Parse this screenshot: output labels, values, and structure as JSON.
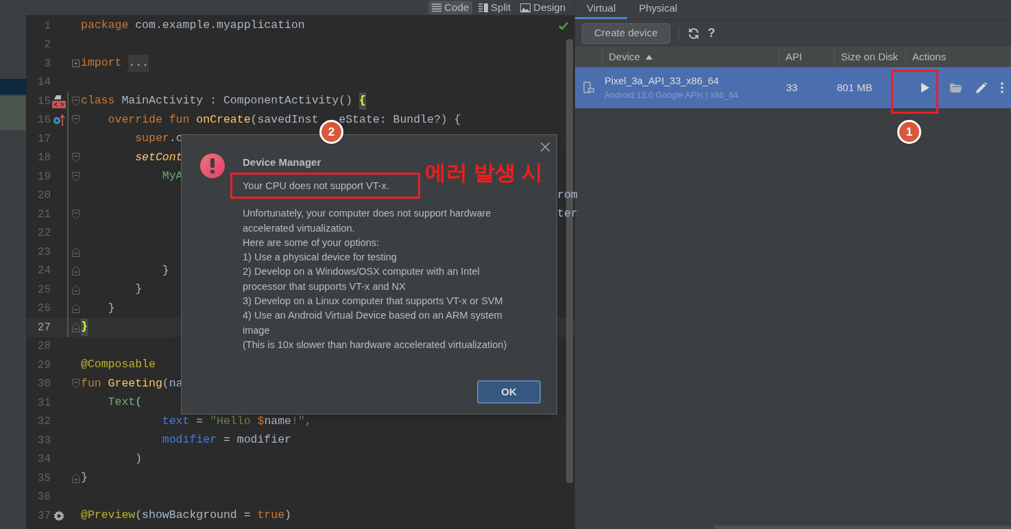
{
  "editor": {
    "view_modes": [
      {
        "label": "Code",
        "selected": true
      },
      {
        "label": "Split",
        "selected": false
      },
      {
        "label": "Design",
        "selected": false
      }
    ],
    "lines": [
      {
        "number": "1",
        "tokens": [
          {
            "text": "package",
            "kind": "keyword"
          },
          {
            "text": " com.example.myapplication",
            "kind": "plain"
          }
        ]
      },
      {
        "number": "2"
      },
      {
        "number": "3",
        "collapsed": true,
        "tokens": [
          {
            "text": "import ",
            "kind": "keyword"
          },
          {
            "text": "...",
            "kind": "folded"
          }
        ]
      },
      {
        "number": "14"
      },
      {
        "number": "15",
        "fold_start": true,
        "changed": true,
        "tokens": [
          {
            "text": "class",
            "kind": "keyword"
          },
          {
            "text": " MainActivity : ComponentActivity() ",
            "kind": "plain"
          },
          {
            "text": "{",
            "kind": "match"
          }
        ]
      },
      {
        "number": "16",
        "fold_start": true,
        "changed": true,
        "tokens": [
          {
            "text": "    override fun ",
            "kind": "keyword"
          },
          {
            "text": "onCreate",
            "kind": "function"
          },
          {
            "text": "(savedInst",
            "kind": "plain"
          },
          {
            "text": "eState: Bundle?) {",
            "kind": "resume"
          }
        ]
      },
      {
        "number": "17",
        "changed": true,
        "tokens": [
          {
            "text": "        super",
            "kind": "keyword"
          },
          {
            "text": ".c",
            "kind": "plain"
          }
        ]
      },
      {
        "number": "18",
        "fold_start": true,
        "changed": true,
        "tokens": [
          {
            "text": "        setCont",
            "kind": "italic"
          }
        ]
      },
      {
        "number": "19",
        "fold_start": true,
        "changed": true,
        "tokens": [
          {
            "text": "            MyA",
            "kind": "composable"
          }
        ]
      },
      {
        "number": "20",
        "changed": true,
        "tokens": [
          {
            "text": "rom",
            "kind": "tail"
          }
        ]
      },
      {
        "number": "21",
        "fold_start": true,
        "changed": true,
        "tokens": [
          {
            "text": "ter",
            "kind": "tail"
          }
        ]
      },
      {
        "number": "22",
        "changed": true
      },
      {
        "number": "23",
        "fold_end": true,
        "changed": true
      },
      {
        "number": "24",
        "fold_end": true,
        "changed": true,
        "tokens": [
          {
            "text": "            }",
            "kind": "plain"
          }
        ]
      },
      {
        "number": "25",
        "fold_end": true,
        "changed": true,
        "tokens": [
          {
            "text": "        }",
            "kind": "plain"
          }
        ]
      },
      {
        "number": "26",
        "fold_end": true,
        "changed": true,
        "tokens": [
          {
            "text": "    }",
            "kind": "plain"
          }
        ]
      },
      {
        "number": "27",
        "fold_end": true,
        "changed": true,
        "current": true,
        "tokens": [
          {
            "text": "}",
            "kind": "match"
          }
        ]
      },
      {
        "number": "28"
      },
      {
        "number": "29",
        "tokens": [
          {
            "text": "@Composable",
            "kind": "annotation"
          }
        ]
      },
      {
        "number": "30",
        "fold_start": true,
        "tokens": [
          {
            "text": "fun ",
            "kind": "keyword"
          },
          {
            "text": "Greeting",
            "kind": "function"
          },
          {
            "text": "(na",
            "kind": "plain"
          }
        ]
      },
      {
        "number": "31",
        "tokens": [
          {
            "text": "    Text",
            "kind": "composable"
          },
          {
            "text": "(",
            "kind": "plain"
          }
        ]
      },
      {
        "number": "32",
        "tokens": [
          {
            "text": "            text",
            "kind": "param"
          },
          {
            "text": " = ",
            "kind": "plain"
          },
          {
            "text": "\"Hello ",
            "kind": "string"
          },
          {
            "text": "$",
            "kind": "keyword"
          },
          {
            "text": "name",
            "kind": "plain"
          },
          {
            "text": "!\"",
            "kind": "string"
          },
          {
            "text": ",",
            "kind": "keyword"
          }
        ]
      },
      {
        "number": "33",
        "tokens": [
          {
            "text": "            modifier",
            "kind": "param"
          },
          {
            "text": " = modifier",
            "kind": "plain"
          }
        ]
      },
      {
        "number": "34",
        "tokens": [
          {
            "text": "        )",
            "kind": "plain"
          }
        ]
      },
      {
        "number": "35",
        "fold_end": true,
        "tokens": [
          {
            "text": "}",
            "kind": "plain"
          }
        ]
      },
      {
        "number": "36"
      },
      {
        "number": "37",
        "tokens": [
          {
            "text": "@Preview",
            "kind": "annotation"
          },
          {
            "text": "(showBackground = ",
            "kind": "plain"
          },
          {
            "text": "true",
            "kind": "keyword"
          },
          {
            "text": ")",
            "kind": "plain"
          }
        ]
      }
    ]
  },
  "device_manager": {
    "tabs": [
      {
        "label": "Virtual",
        "selected": true
      },
      {
        "label": "Physical",
        "selected": false
      }
    ],
    "create_button": "Create device",
    "help": "?",
    "columns": [
      {
        "label": "Device",
        "sorted": true
      },
      {
        "label": "API",
        "sorted": false
      },
      {
        "label": "Size on Disk",
        "sorted": false
      },
      {
        "label": "Actions",
        "sorted": false
      }
    ],
    "rows": [
      {
        "name": "Pixel_3a_API_33_x86_64",
        "subtitle": "Android 13.0 Google APIs | x86_64",
        "api": "33",
        "size": "801 MB",
        "selected": true
      }
    ]
  },
  "dialog": {
    "title": "Device Manager",
    "headline": "Your CPU does not support VT-x.",
    "body": [
      "Unfortunately, your computer does not support hardware accelerated virtualization.",
      "Here are some of your options:",
      "1) Use a physical device for testing",
      "2) Develop on a Windows/OSX computer with an Intel processor that supports VT-x and NX",
      "3) Develop on a Linux computer that supports VT-x or SVM",
      "4) Use an Android Virtual Device based on an ARM system image",
      "(This is 10x slower than hardware accelerated virtualization)"
    ],
    "ok_button": "OK"
  },
  "annotations": {
    "badges": [
      {
        "label": "2"
      },
      {
        "label": "1"
      }
    ],
    "note": "에러 발생 시"
  }
}
